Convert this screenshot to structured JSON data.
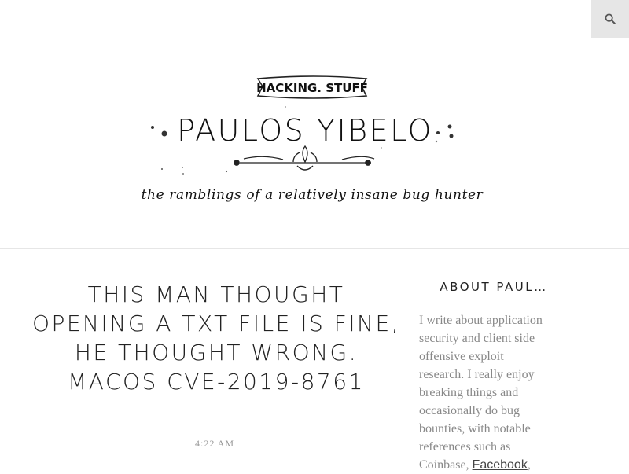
{
  "header": {
    "search_icon": "search-icon",
    "badge": "HACKING. STUFF",
    "site_title": "PAULOS YIBELO",
    "tagline": "the ramblings of a relatively insane bug hunter"
  },
  "post": {
    "title": "This man thought opening a TXT file is fine, he thought wrong. macOS CVE-2019-8761",
    "time": "4:22 AM"
  },
  "sidebar": {
    "widget_title": "ABOUT PAUL…",
    "about_text": "I write about application security and client side offensive exploit research. I really enjoy breaking things and occasionally do bug bounties, with notable references such as Coinbase, ",
    "link_facebook": "Facebook",
    "after_link": ","
  }
}
